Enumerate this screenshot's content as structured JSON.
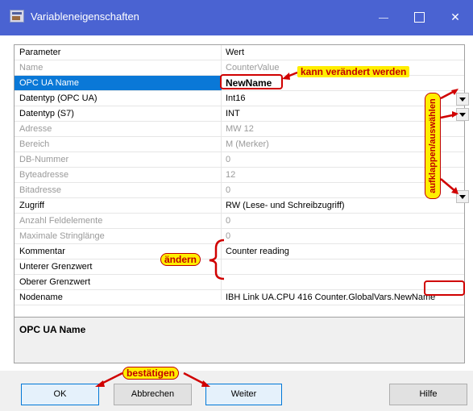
{
  "window": {
    "title": "Variableneigenschaften",
    "minimize_label": "–",
    "maximize_label": "",
    "close_label": "✕"
  },
  "grid": {
    "headers": {
      "parameter": "Parameter",
      "value": "Wert"
    },
    "rows": [
      {
        "param": "Name",
        "value": "CounterValue",
        "disabled": true
      },
      {
        "param": "OPC UA Name",
        "value": "NewName",
        "selected": true
      },
      {
        "param": "Datentyp (OPC UA)",
        "value": "Int16",
        "dropdown": true
      },
      {
        "param": "Datentyp (S7)",
        "value": "INT",
        "dropdown": true
      },
      {
        "param": "Adresse",
        "value": "MW 12",
        "disabled": true
      },
      {
        "param": "Bereich",
        "value": "M (Merker)",
        "disabled": true
      },
      {
        "param": "DB-Nummer",
        "value": "0",
        "disabled": true
      },
      {
        "param": "Byteadresse",
        "value": "12",
        "disabled": true
      },
      {
        "param": "Bitadresse",
        "value": "0",
        "disabled": true
      },
      {
        "param": "Zugriff",
        "value": "RW (Lese- und Schreibzugriff)",
        "dropdown": true
      },
      {
        "param": "Anzahl Feldelemente",
        "value": "0",
        "disabled": true
      },
      {
        "param": "Maximale Stringlänge",
        "value": "0",
        "disabled": true
      },
      {
        "param": "Kommentar",
        "value": "Counter reading"
      },
      {
        "param": "Unterer Grenzwert",
        "value": ""
      },
      {
        "param": "Oberer Grenzwert",
        "value": ""
      },
      {
        "param": "Nodename",
        "value_prefix": "IBH Link UA.CPU 416 Counter.GlobalVars.",
        "value_suffix": "NewName"
      }
    ]
  },
  "description": {
    "title": "OPC UA Name"
  },
  "buttons": {
    "ok": "OK",
    "cancel": "Abbrechen",
    "next": "Weiter",
    "help": "Hilfe"
  },
  "annotations": {
    "editable": "kann verändert werden",
    "dropdown": "aufklappen/auswählen",
    "change": "ändern",
    "confirm": "bestätigen"
  },
  "colors": {
    "titlebar": "#4a63d2",
    "selection": "#0a78d7",
    "callout_fill": "#ffee00",
    "annotation_red": "#c00000"
  }
}
